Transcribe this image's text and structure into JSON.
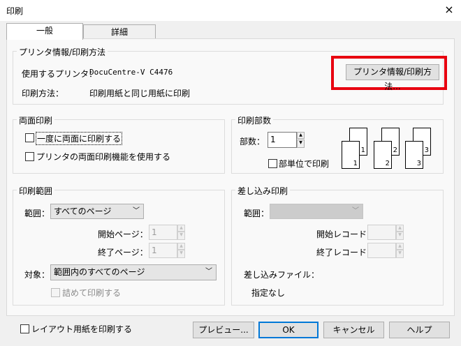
{
  "window": {
    "title": "印刷",
    "close_icon": "×"
  },
  "tabs": [
    {
      "label": "一般",
      "active": true
    },
    {
      "label": "詳細",
      "active": false
    }
  ],
  "printer_info": {
    "legend": "プリンタ情報/印刷方法",
    "printer_label": "使用するプリンタ：",
    "printer_value": "DocuCentre-V C4476",
    "method_label": "印刷方法：",
    "method_value": "印刷用紙と同じ用紙に印刷",
    "button_label": "プリンタ情報/印刷方法..."
  },
  "duplex": {
    "legend": "両面印刷",
    "option1": "一度に両面に印刷する",
    "option2": "プリンタの両面印刷機能を使用する"
  },
  "copies": {
    "legend": "印刷部数",
    "count_label": "部数：",
    "count_value": "1",
    "collate_label": "部単位で印刷",
    "pages": [
      "1",
      "1",
      "2",
      "2",
      "3",
      "3"
    ]
  },
  "range": {
    "legend": "印刷範囲",
    "range_label": "範囲：",
    "range_value": "すべてのページ",
    "start_label": "開始ページ：",
    "start_value": "1",
    "end_label": "終了ページ：",
    "end_value": "1",
    "target_label": "対象：",
    "target_value": "範囲内のすべてのページ",
    "compact_label": "詰めて印刷する"
  },
  "merge": {
    "legend": "差し込み印刷",
    "range_label": "範囲：",
    "start_label": "開始レコード：",
    "end_label": "終了レコード：",
    "file_label": "差し込みファイル：",
    "file_value": "指定なし"
  },
  "footer": {
    "layout_label": "レイアウト用紙を印刷する",
    "preview": "プレビュー...",
    "ok": "OK",
    "cancel": "キャンセル",
    "help": "ヘルプ"
  },
  "colors": {
    "highlight": "#e8000f",
    "default_border": "#0078d7"
  }
}
